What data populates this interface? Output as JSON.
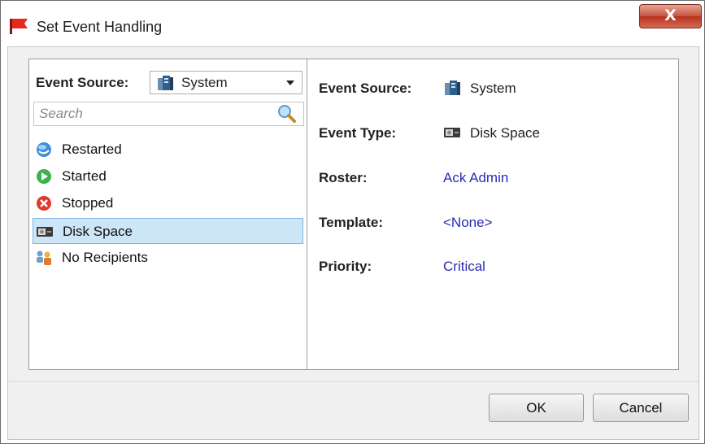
{
  "window": {
    "title": "Set Event Handling",
    "close_glyph": "X"
  },
  "left_panel": {
    "source_label": "Event Source:",
    "source_selected": "System",
    "search_placeholder": "Search",
    "events": [
      {
        "label": "Restarted",
        "icon": "restart-globe-icon",
        "selected": false
      },
      {
        "label": "Started",
        "icon": "play-icon",
        "selected": false
      },
      {
        "label": "Stopped",
        "icon": "stop-x-icon",
        "selected": false
      },
      {
        "label": "Disk Space",
        "icon": "disk-drive-icon",
        "selected": true
      },
      {
        "label": "No Recipients",
        "icon": "users-icon",
        "selected": false
      }
    ]
  },
  "details": {
    "event_source_label": "Event Source:",
    "event_source_value": "System",
    "event_type_label": "Event Type:",
    "event_type_value": "Disk Space",
    "roster_label": "Roster:",
    "roster_value": "Ack Admin",
    "template_label": "Template:",
    "template_value": "<None>",
    "priority_label": "Priority:",
    "priority_value": "Critical"
  },
  "buttons": {
    "ok": "OK",
    "cancel": "Cancel"
  },
  "colors": {
    "link": "#2b2bb5",
    "selection": "#cde6f7",
    "selection_border": "#7eb4ea"
  }
}
